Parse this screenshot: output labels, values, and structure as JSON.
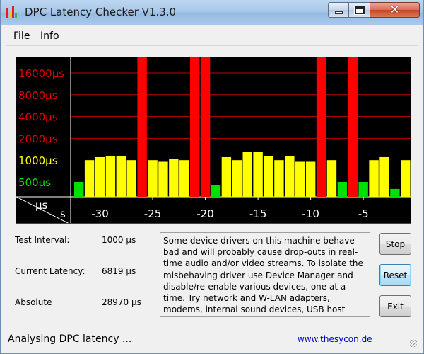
{
  "window": {
    "title": "DPC Latency Checker V1.3.0",
    "icon": "bar-chart-app-icon"
  },
  "menu": {
    "file": {
      "mnemonic": "F",
      "rest": "ile"
    },
    "info": {
      "mnemonic": "I",
      "rest": "nfo"
    }
  },
  "chart_data": {
    "type": "bar",
    "title": "",
    "y_scale": "log",
    "y_labels": [
      {
        "text": "16000µs",
        "color": "#e00000"
      },
      {
        "text": "8000µs",
        "color": "#e00000"
      },
      {
        "text": "4000µs",
        "color": "#e00000"
      },
      {
        "text": "2000µs",
        "color": "#e00000"
      },
      {
        "text": "1000µs",
        "color": "#ffff00"
      },
      {
        "text": "500µs",
        "color": "#00e000"
      }
    ],
    "y_values_us": [
      16000,
      8000,
      4000,
      2000,
      1000,
      500
    ],
    "x_unit_label": "s",
    "y_unit_label": "µs",
    "x_ticks": [
      -30,
      -25,
      -20,
      -15,
      -10,
      -5
    ],
    "x_tick_labels": [
      "-30",
      "-25",
      "-20",
      "-15",
      "-10",
      "-5"
    ],
    "time_range_s": [
      -32,
      0
    ],
    "colors": {
      "green": "#00e000",
      "yellow": "#ffff00",
      "red": "#ff0000",
      "grid": "#c00000"
    },
    "bars": [
      {
        "t": -32.0,
        "value_us": 500,
        "color": "green"
      },
      {
        "t": -31.0,
        "value_us": 1000,
        "color": "yellow"
      },
      {
        "t": -30.0,
        "value_us": 1100,
        "color": "yellow"
      },
      {
        "t": -29.0,
        "value_us": 1150,
        "color": "yellow"
      },
      {
        "t": -28.0,
        "value_us": 1150,
        "color": "yellow"
      },
      {
        "t": -27.0,
        "value_us": 1000,
        "color": "yellow"
      },
      {
        "t": -26.0,
        "value_us": 28970,
        "color": "red"
      },
      {
        "t": -25.0,
        "value_us": 1000,
        "color": "yellow"
      },
      {
        "t": -24.0,
        "value_us": 950,
        "color": "yellow"
      },
      {
        "t": -23.0,
        "value_us": 1050,
        "color": "yellow"
      },
      {
        "t": -22.0,
        "value_us": 1000,
        "color": "yellow"
      },
      {
        "t": -21.0,
        "value_us": 28970,
        "color": "red"
      },
      {
        "t": -20.0,
        "value_us": 28970,
        "color": "red"
      },
      {
        "t": -19.0,
        "value_us": 450,
        "color": "green"
      },
      {
        "t": -18.0,
        "value_us": 1100,
        "color": "yellow"
      },
      {
        "t": -17.0,
        "value_us": 1000,
        "color": "yellow"
      },
      {
        "t": -16.0,
        "value_us": 1300,
        "color": "yellow"
      },
      {
        "t": -15.0,
        "value_us": 1300,
        "color": "yellow"
      },
      {
        "t": -14.0,
        "value_us": 1150,
        "color": "yellow"
      },
      {
        "t": -13.0,
        "value_us": 1000,
        "color": "yellow"
      },
      {
        "t": -12.0,
        "value_us": 1150,
        "color": "yellow"
      },
      {
        "t": -11.0,
        "value_us": 950,
        "color": "yellow"
      },
      {
        "t": -10.0,
        "value_us": 950,
        "color": "yellow"
      },
      {
        "t": -9.0,
        "value_us": 28970,
        "color": "red"
      },
      {
        "t": -8.0,
        "value_us": 1000,
        "color": "yellow"
      },
      {
        "t": -7.0,
        "value_us": 500,
        "color": "green"
      },
      {
        "t": -6.0,
        "value_us": 16500,
        "color": "red"
      },
      {
        "t": -5.0,
        "value_us": 500,
        "color": "green"
      },
      {
        "t": -4.0,
        "value_us": 1000,
        "color": "yellow"
      },
      {
        "t": -3.0,
        "value_us": 1100,
        "color": "yellow"
      },
      {
        "t": -2.0,
        "value_us": 400,
        "color": "green"
      },
      {
        "t": -1.0,
        "value_us": 1000,
        "color": "yellow"
      }
    ]
  },
  "stats": {
    "test_interval_label": "Test Interval:",
    "test_interval_value": "1000 µs",
    "current_latency_label": "Current Latency:",
    "current_latency_value": "6819 µs",
    "absolute_label": "Absolute",
    "absolute_value": "28970 µs"
  },
  "message": "Some device drivers on this machine behave bad and will probably cause drop-outs in real-time audio and/or video streams. To isolate the misbehaving driver use Device Manager and disable/re-enable various devices, one at a time. Try network and W-LAN adapters, modems, internal sound devices, USB host controllers, etc.",
  "buttons": {
    "stop": "Stop",
    "reset": "Reset",
    "exit": "Exit"
  },
  "status": {
    "text": "Analysing DPC latency ...",
    "link": "www.thesycon.de"
  }
}
